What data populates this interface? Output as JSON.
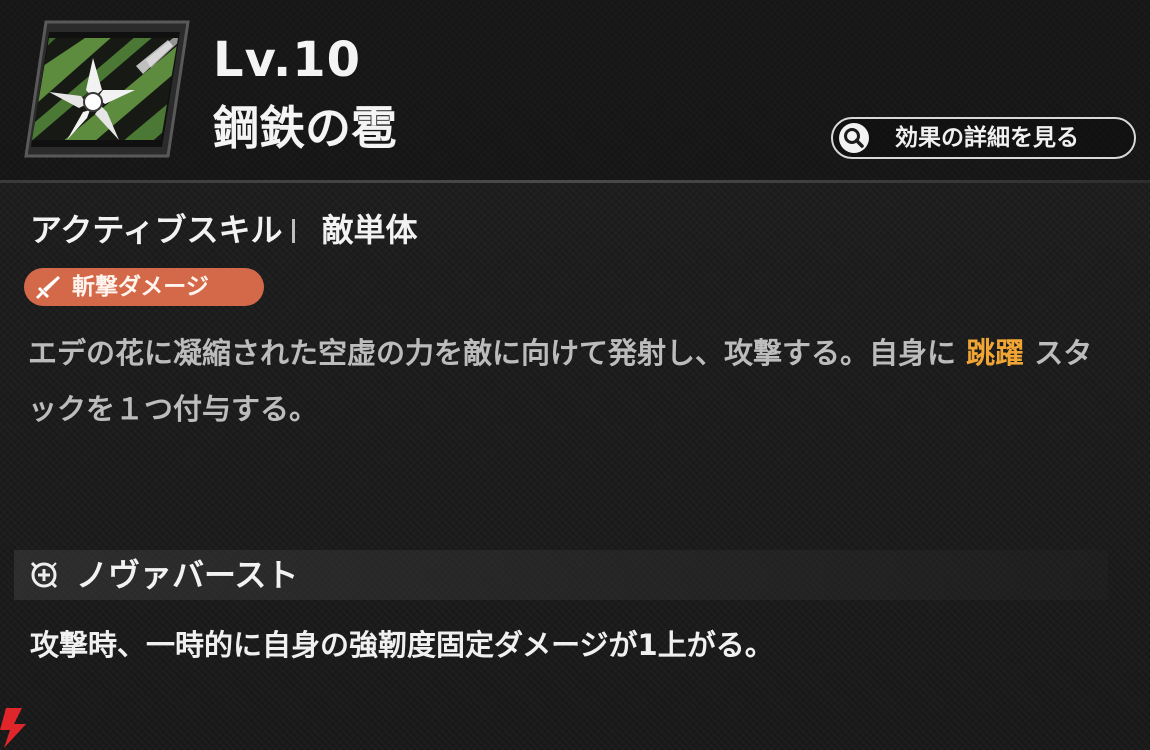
{
  "header": {
    "level": "Lv.10",
    "skill_name": "鋼鉄の雹",
    "skill_icon": "white-star-flower-icon",
    "detail_button": {
      "icon": "search-icon",
      "label": "効果の詳細を見る"
    }
  },
  "skill": {
    "type": "アクティブスキル",
    "target": "敵単体",
    "damage_badge": {
      "icon": "sword-icon",
      "label": "斬撃ダメージ",
      "color": "#d4694a"
    },
    "description": {
      "before": "エデの花に凝縮された空虚の力を敵に向けて発射し、攻撃する。自身に",
      "highlight": "跳躍",
      "after": "スタックを１つ付与する。",
      "highlight_color": "#f0a535"
    }
  },
  "nova_burst": {
    "icon": "nova-burst-icon",
    "title": "ノヴァバースト",
    "description": "攻撃時、一時的に自身の強靭度固定ダメージが1上がる。"
  },
  "colors": {
    "background": "#1b1b1b",
    "text": "#f2f2f2",
    "muted_text": "#bcbcbc",
    "accent": "#f0a535"
  }
}
